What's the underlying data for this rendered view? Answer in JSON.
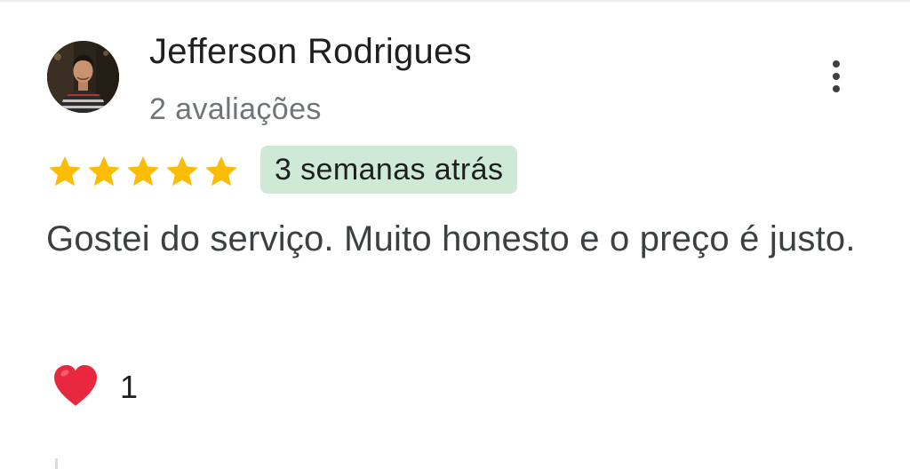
{
  "review": {
    "author_name": "Jefferson Rodrigues",
    "review_count": "2 avaliações",
    "rating": 5,
    "rating_max": 5,
    "time_ago": "3 semanas atrás",
    "text": "Gostei do serviço. Muito honesto e o preço é justo.",
    "reaction_icon": "heart-icon",
    "reaction_count": "1"
  },
  "icons": {
    "menu": "more-vert-icon",
    "star": "star-icon",
    "avatar": "avatar-photo"
  },
  "colors": {
    "star": "#fbbc04",
    "badge_bg": "#ceead6",
    "heart": "#e8283f",
    "secondary_text": "#70757a",
    "primary_text": "#1f1f1f"
  }
}
